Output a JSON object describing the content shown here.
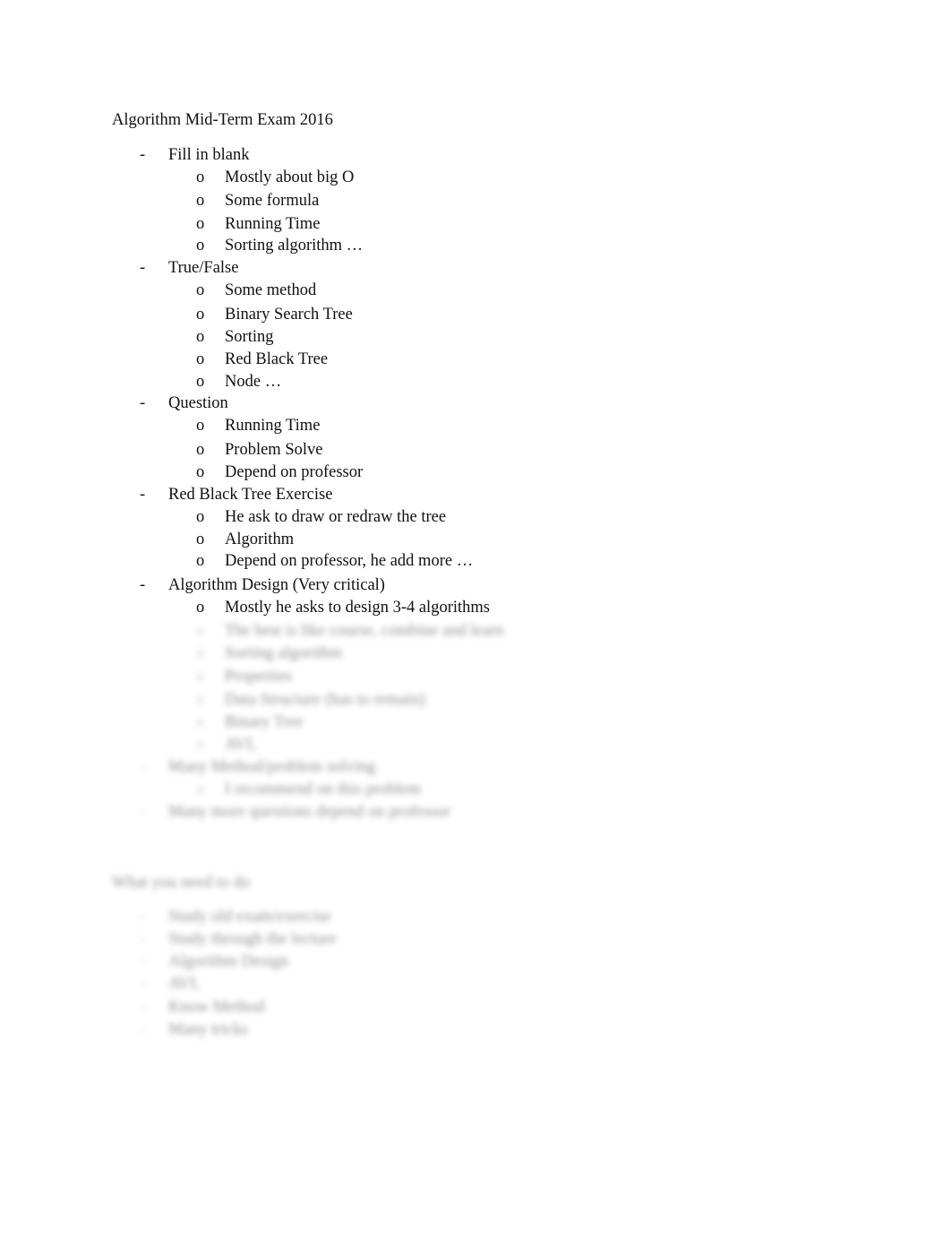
{
  "document": {
    "title": "Algorithm Mid-Term Exam 2016",
    "sections": [
      {
        "label": "Fill in blank",
        "items": [
          "Mostly about big O",
          "Some formula",
          "Running Time",
          "Sorting algorithm …"
        ]
      },
      {
        "label": "True/False",
        "items": [
          "Some method",
          "Binary Search Tree",
          "Sorting",
          "Red Black Tree",
          "Node …"
        ]
      },
      {
        "label": "Question",
        "items": [
          "Running Time",
          "Problem Solve",
          "Depend on professor"
        ]
      },
      {
        "label": "Red Black Tree Exercise",
        "items": [
          "He ask to draw or redraw the tree",
          "Algorithm",
          "Depend on professor, he add more  …"
        ]
      },
      {
        "label": "Algorithm Design (Very critical)",
        "items": [
          "Mostly he asks to design 3-4 algorithms"
        ]
      }
    ],
    "markers": {
      "level1": "-",
      "level2": "o"
    },
    "blurred_preview": {
      "algorithm_design_more_items": [
        "The best is like course, combine and learn",
        "Sorting algorithm",
        "Properties",
        "Data Structure (has to remain)",
        "Binary Tree",
        "AVL"
      ],
      "more_sections": [
        {
          "label": "Many Method/problem solving",
          "items": [
            "I recommend on this problem"
          ]
        },
        {
          "label": "Many more questions depend on professor",
          "items": []
        }
      ],
      "second_heading": "What you need to do",
      "second_items": [
        "Study old exam/exercise",
        "Study through the lecture",
        "Algorithm Design",
        "AVL",
        "Know Method",
        "Many tricks"
      ]
    }
  }
}
